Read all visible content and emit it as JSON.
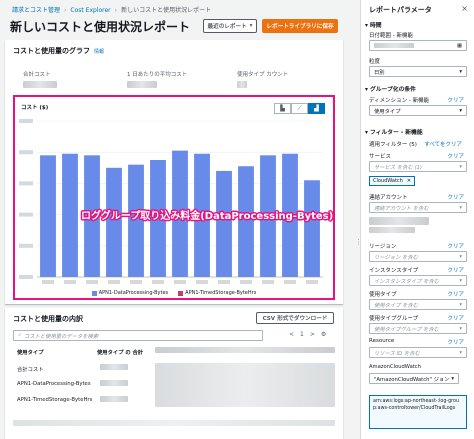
{
  "breadcrumb": [
    "請求とコスト管理",
    "Cost Explorer",
    "新しいコストと使用状況レポート"
  ],
  "page_title": "新しいコストと使用状況レポート",
  "buttons": {
    "recent_reports": "最近のレポート",
    "save_to_library": "レポートライブラリに保存",
    "csv_download": "CSV 形式でダウンロード"
  },
  "graph_section": {
    "title": "コストと使用量のグラフ",
    "info": "情報",
    "metrics": [
      "合計コスト",
      "1 日あたりの平均コスト",
      "使用タイプ カウント"
    ],
    "chart_label": "コスト ($)",
    "view_icons": [
      "bar-icon",
      "line-icon",
      "stacked-bar-icon"
    ]
  },
  "overlay_annotation": "ロググループ取り込み料金(DataProcessing-Bytes)",
  "chart_data": {
    "type": "bar",
    "stacked": true,
    "categories": [
      "",
      "",
      "",
      "",
      "",
      "",
      "",
      "",
      "",
      "",
      "",
      "",
      ""
    ],
    "series": [
      {
        "name": "APN1-DataProcessing-Bytes",
        "color": "#688ae8",
        "values": [
          0.78,
          0.79,
          0.78,
          0.7,
          0.72,
          0.75,
          0.81,
          0.79,
          0.68,
          0.71,
          0.78,
          0.79,
          0.62
        ]
      },
      {
        "name": "APN1-TimedStorage-ByteHrs",
        "color": "#c33d69",
        "values": [
          0,
          0,
          0,
          0,
          0,
          0,
          0,
          0,
          0,
          0,
          0,
          0,
          0
        ]
      }
    ],
    "ylim": [
      0,
      1
    ],
    "grid": true,
    "legend_position": "bottom"
  },
  "breakdown": {
    "title": "コストと使用量の内訳",
    "search_placeholder": "コストと使用量のデータを検索",
    "pager": [
      "<",
      "1",
      ">"
    ],
    "headers": [
      "使用タイプ",
      "使用タイプ の 合計"
    ],
    "rows": [
      "合計コスト",
      "APN1-DataProcessing-Bytes",
      "APN1-TimedStorage-ByteHrs"
    ]
  },
  "panel": {
    "title": "レポートパラメータ",
    "time_label": "時間",
    "date_range_label": "日付範囲 - 新機能",
    "granularity_label": "粒度",
    "granularity_value": "日別",
    "group_section": "グループ化の条件",
    "dimension_label": "ディメンション - 新機能",
    "dimension_value": "使用タイプ",
    "filter_section": "フィルター - 新機能",
    "applied_filters": "適用フィルター (5)",
    "clear_all": "すべてをクリア",
    "service_label": "サービス",
    "service_placeholder": "サービス を含む (1)",
    "service_token": "CloudWatch",
    "account_label": "連結アカウント",
    "account_placeholder": "連結アカウント を含む",
    "region_label": "リージョン",
    "region_placeholder": "リージョン を含む",
    "instance_label": "インスタンスタイプ",
    "instance_placeholder": "インスタンスタイプ を含む",
    "usage_type_label": "使用タイプ",
    "usage_type_placeholder": "使用タイプ を含む",
    "usage_group_label": "使用タイプグループ",
    "usage_group_placeholder": "使用タイプグループ を含む",
    "resource_label": "Resource",
    "resource_placeholder": "リソース ID を含む",
    "resource_value": "AmazonCloudWatch",
    "resource_token": "\"AmazonCloudWatch\" ジョン",
    "log_group_arn": "arn:aws:logs:ap-northeast-:log-group:aws-controltower/CloudTrailLogs",
    "clear": "クリア",
    "close": "×"
  }
}
